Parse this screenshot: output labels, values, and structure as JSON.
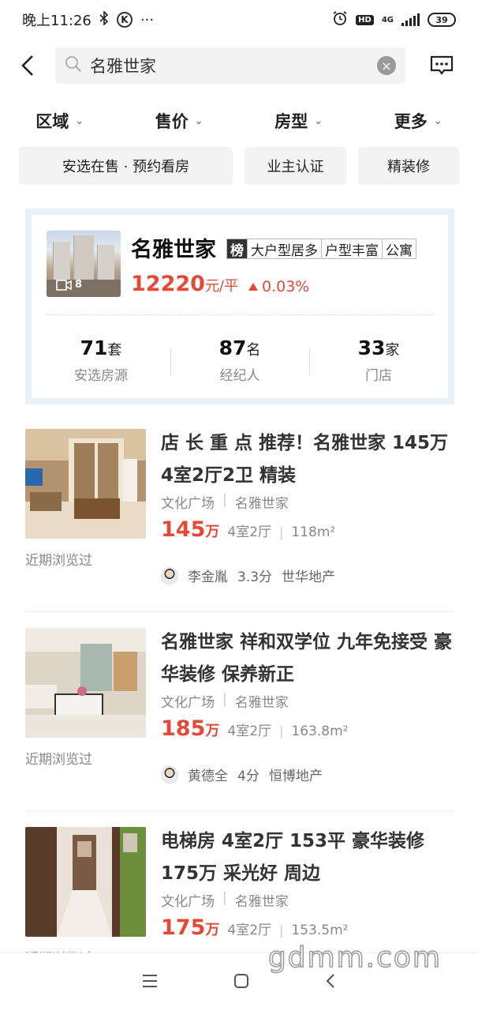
{
  "status_bar": {
    "time": "晚上11:26",
    "network": "4G",
    "hd": "HD",
    "battery": "39"
  },
  "search": {
    "query": "名雅世家",
    "placeholder": "名雅世家"
  },
  "filters": [
    {
      "label": "区域"
    },
    {
      "label": "售价"
    },
    {
      "label": "房型"
    },
    {
      "label": "更多"
    }
  ],
  "tags": [
    {
      "label": "安选在售 · 预约看房"
    },
    {
      "label": "业主认证"
    },
    {
      "label": "精装修"
    }
  ],
  "community": {
    "name": "名雅世家",
    "rank_badge": "榜",
    "tags": [
      "大户型居多",
      "户型丰富",
      "公寓"
    ],
    "price": "12220",
    "price_unit": "元/平",
    "change": "0.03%",
    "video_count": "8",
    "stats": [
      {
        "num": "71",
        "unit": "套",
        "label": "安选房源"
      },
      {
        "num": "87",
        "unit": "名",
        "label": "经纪人"
      },
      {
        "num": "33",
        "unit": "家",
        "label": "门店"
      }
    ]
  },
  "listings": [
    {
      "title": "店 长 重 点 推荐！名雅世家 145万 4室2厅2卫 精装",
      "district": "文化广场",
      "community": "名雅世家",
      "price": "145",
      "price_unit": "万",
      "rooms": "4室2厅",
      "area": "118m²",
      "recent": "近期浏览过",
      "agent": "李金胤",
      "score": "3.3分",
      "company": "世华地产"
    },
    {
      "title": "名雅世家 祥和双学位 九年免接受 豪华装修 保养新正",
      "district": "文化广场",
      "community": "名雅世家",
      "price": "185",
      "price_unit": "万",
      "rooms": "4室2厅",
      "area": "163.8m²",
      "recent": "近期浏览过",
      "agent": "黄德全",
      "score": "4分",
      "company": "恒博地产"
    },
    {
      "title": "电梯房 4室2厅 153平 豪华装修 175万 采光好 周边",
      "district": "文化广场",
      "community": "名雅世家",
      "price": "175",
      "price_unit": "万",
      "rooms": "4室2厅",
      "area": "153.5m²",
      "recent": "近期浏览过"
    }
  ],
  "watermark": "gdmm.com",
  "colors": {
    "accent_red": "#e24a37",
    "card_border": "#e8f0fa"
  }
}
